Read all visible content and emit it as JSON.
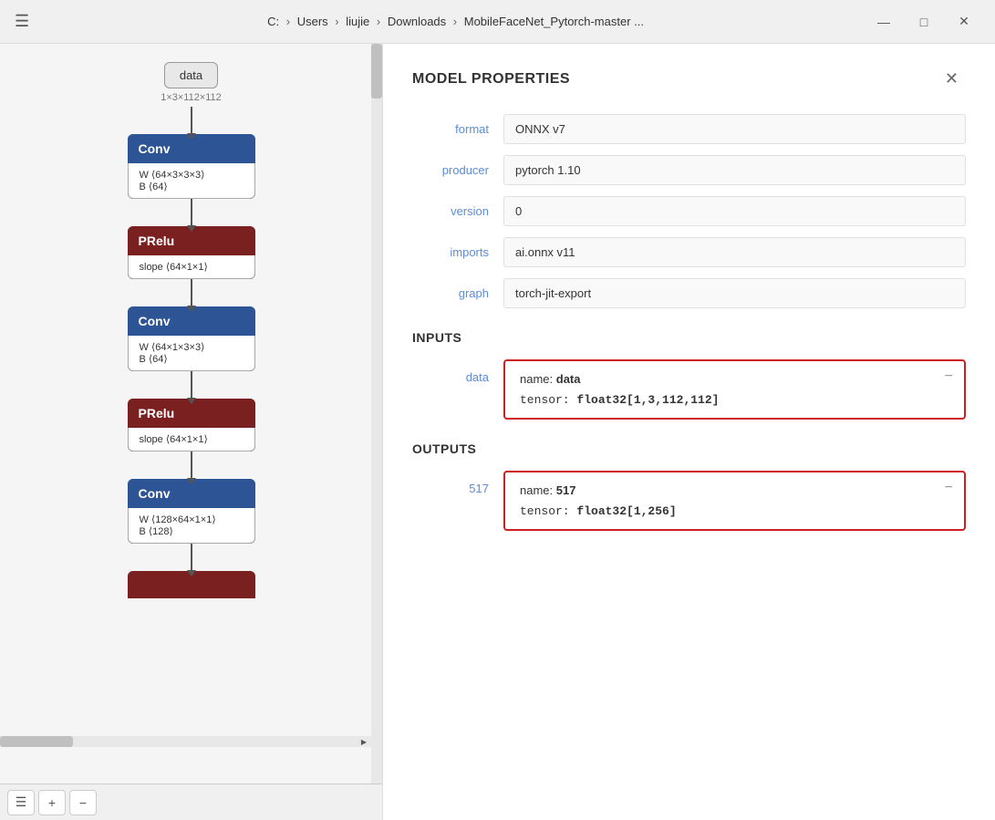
{
  "titlebar": {
    "menu_icon": "☰",
    "path_parts": [
      "C:",
      "Users",
      "liujie",
      "Downloads",
      "MobileFaceNet_Pytorch-master ..."
    ],
    "separators": [
      "›",
      "›",
      "›",
      "›"
    ],
    "minimize_icon": "—",
    "maximize_icon": "□",
    "close_icon": "✕"
  },
  "graph": {
    "data_node_label": "data",
    "shape_label": "1×3×112×112",
    "conv1": {
      "title": "Conv",
      "w": "W ⟨64×3×3×3⟩",
      "b": "B ⟨64⟩"
    },
    "prelu1": {
      "title": "PRelu",
      "slope": "slope ⟨64×1×1⟩"
    },
    "conv2": {
      "title": "Conv",
      "w": "W ⟨64×1×3×3⟩",
      "b": "B ⟨64⟩"
    },
    "prelu2": {
      "title": "PRelu",
      "slope": "slope ⟨64×1×1⟩"
    },
    "conv3": {
      "title": "Conv",
      "w": "W ⟨128×64×1×1⟩",
      "b": "B ⟨128⟩"
    }
  },
  "toolbar": {
    "list_icon": "☰",
    "plus_icon": "+",
    "minus_icon": "−"
  },
  "properties": {
    "title": "MODEL PROPERTIES",
    "close_icon": "✕",
    "fields": [
      {
        "label": "format",
        "value": "ONNX v7"
      },
      {
        "label": "producer",
        "value": "pytorch 1.10"
      },
      {
        "label": "version",
        "value": "0"
      },
      {
        "label": "imports",
        "value": "ai.onnx v11"
      },
      {
        "label": "graph",
        "value": "torch-jit-export"
      }
    ],
    "inputs_section": "INPUTS",
    "inputs": [
      {
        "label": "data",
        "name_prefix": "name: ",
        "name_value": "data",
        "tensor_prefix": "tensor: ",
        "tensor_value": "float32[1,3,112,112]"
      }
    ],
    "outputs_section": "OUTPUTS",
    "outputs": [
      {
        "label": "517",
        "name_prefix": "name: ",
        "name_value": "517",
        "tensor_prefix": "tensor: ",
        "tensor_value": "float32[1,256]"
      }
    ]
  }
}
